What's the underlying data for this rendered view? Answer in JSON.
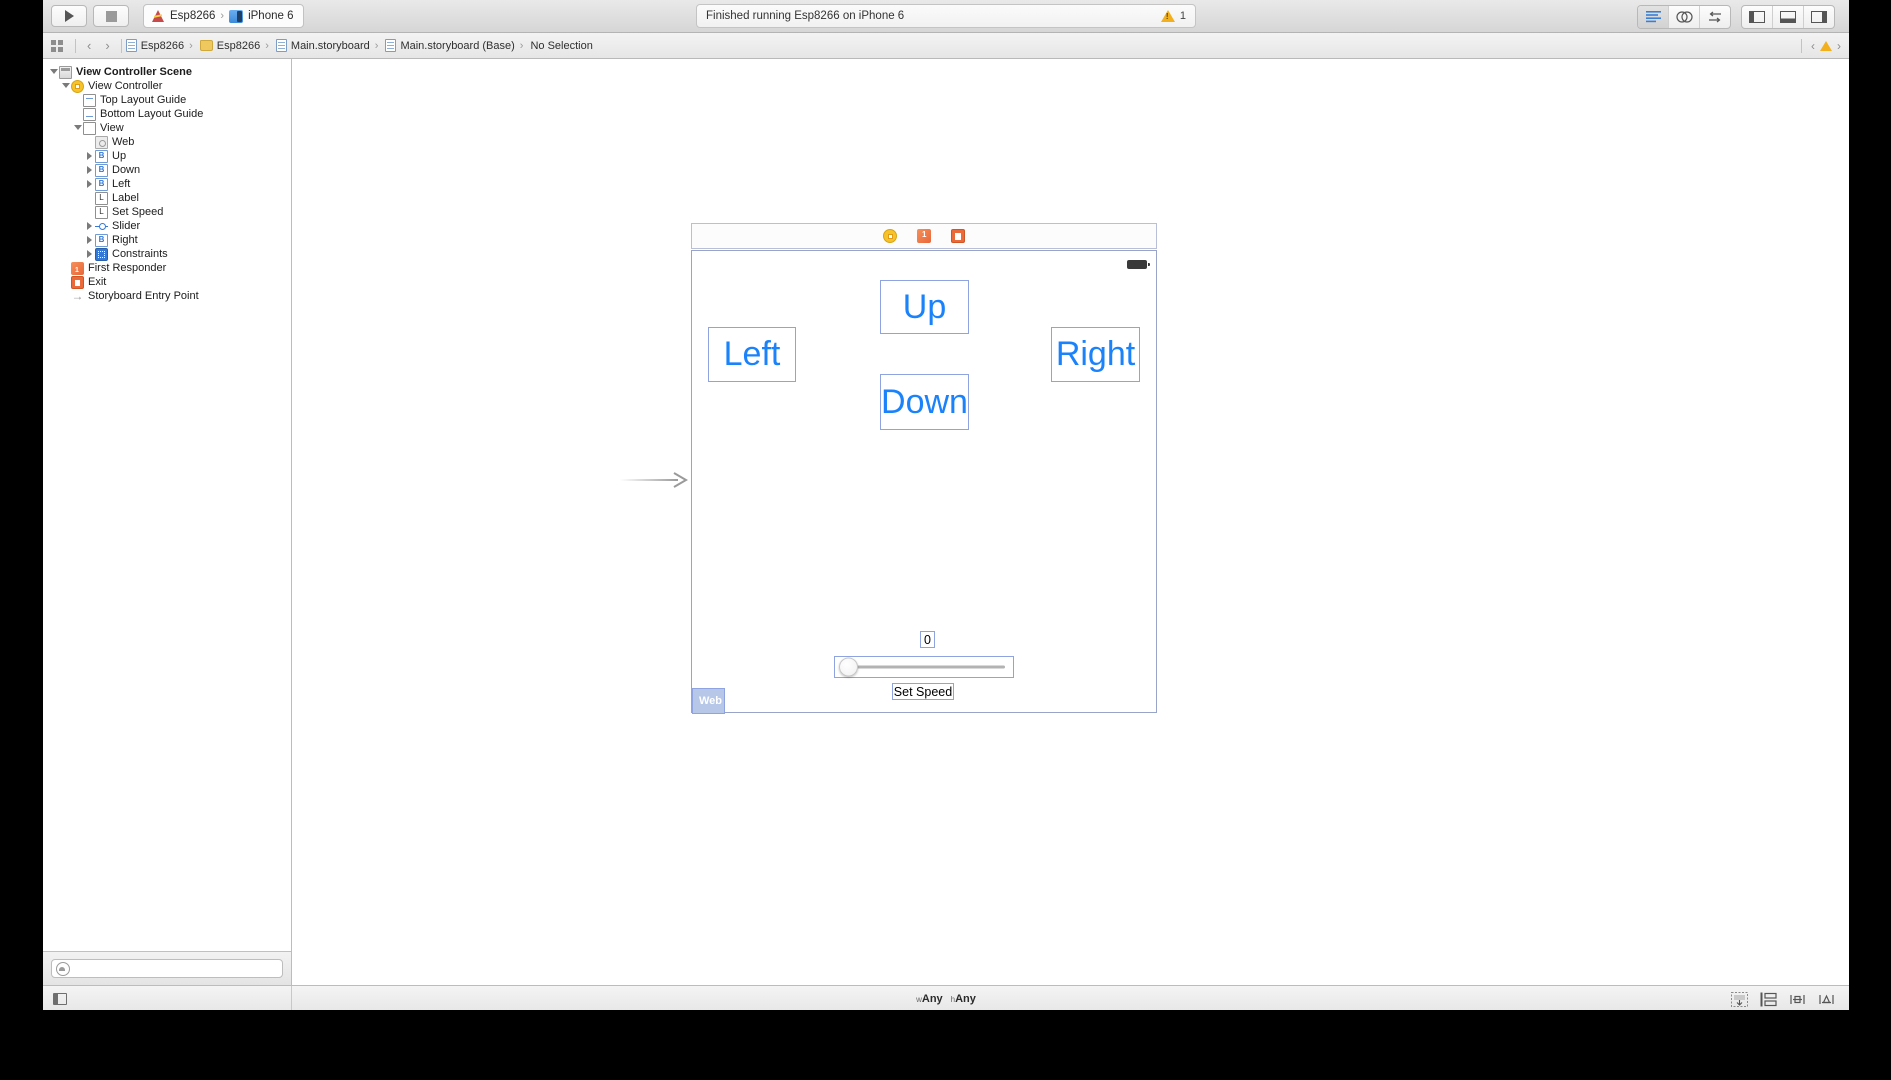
{
  "toolbar": {
    "run_label": "Run",
    "stop_label": "Stop",
    "scheme": {
      "project": "Esp8266",
      "destination": "iPhone 6",
      "separator": "›"
    },
    "status": {
      "message": "Finished running Esp8266 on iPhone 6",
      "warning_count": "1"
    },
    "right_buttons": [
      {
        "name": "standard-editor",
        "label": "Standard Editor"
      },
      {
        "name": "assistant-editor",
        "label": "Assistant Editor"
      },
      {
        "name": "version-editor",
        "label": "Version Editor"
      }
    ],
    "panel_buttons": [
      {
        "name": "navigator-toggle",
        "label": "Hide Navigator"
      },
      {
        "name": "debug-toggle",
        "label": "Hide Debug Area"
      },
      {
        "name": "utilities-toggle",
        "label": "Hide Utilities"
      }
    ]
  },
  "jumpbar": {
    "back_label": "‹",
    "forward_label": "›",
    "crumbs": [
      {
        "label": "Esp8266",
        "icon": "project-icon"
      },
      {
        "label": "Esp8266",
        "icon": "folder-icon"
      },
      {
        "label": "Main.storyboard",
        "icon": "document-icon"
      },
      {
        "label": "Main.storyboard (Base)",
        "icon": "document-icon"
      },
      {
        "label": "No Selection",
        "icon": "none"
      }
    ],
    "separator": "›",
    "issue_prev": "‹",
    "issue_next": "›"
  },
  "outline": {
    "items": [
      {
        "label": "View Controller Scene",
        "indent": 0,
        "disclosure": "open",
        "icon": "scene-icon",
        "bold": true
      },
      {
        "label": "View Controller",
        "indent": 1,
        "disclosure": "open",
        "icon": "view-controller-icon",
        "bold": false
      },
      {
        "label": "Top Layout Guide",
        "indent": 2,
        "disclosure": "none",
        "icon": "top-layout-guide-icon",
        "bold": false
      },
      {
        "label": "Bottom Layout Guide",
        "indent": 2,
        "disclosure": "none",
        "icon": "bottom-layout-guide-icon",
        "bold": false
      },
      {
        "label": "View",
        "indent": 2,
        "disclosure": "open",
        "icon": "view-icon",
        "bold": false
      },
      {
        "label": "Web",
        "indent": 3,
        "disclosure": "none",
        "icon": "web-view-icon",
        "bold": false
      },
      {
        "label": "Up",
        "indent": 3,
        "disclosure": "closed",
        "icon": "button-icon",
        "bold": false
      },
      {
        "label": "Down",
        "indent": 3,
        "disclosure": "closed",
        "icon": "button-icon",
        "bold": false
      },
      {
        "label": "Left",
        "indent": 3,
        "disclosure": "closed",
        "icon": "button-icon",
        "bold": false
      },
      {
        "label": "Label",
        "indent": 3,
        "disclosure": "none",
        "icon": "label-icon",
        "bold": false
      },
      {
        "label": "Set Speed",
        "indent": 3,
        "disclosure": "none",
        "icon": "label-icon",
        "bold": false
      },
      {
        "label": "Slider",
        "indent": 3,
        "disclosure": "closed",
        "icon": "slider-icon",
        "bold": false
      },
      {
        "label": "Right",
        "indent": 3,
        "disclosure": "closed",
        "icon": "button-icon",
        "bold": false
      },
      {
        "label": "Constraints",
        "indent": 3,
        "disclosure": "closed",
        "icon": "constraints-icon",
        "bold": false
      },
      {
        "label": "First Responder",
        "indent": 1,
        "disclosure": "none",
        "icon": "first-responder-icon",
        "bold": false
      },
      {
        "label": "Exit",
        "indent": 1,
        "disclosure": "none",
        "icon": "exit-icon",
        "bold": false
      },
      {
        "label": "Storyboard Entry Point",
        "indent": 1,
        "disclosure": "none",
        "icon": "entry-point-icon",
        "bold": false
      }
    ],
    "filter": {
      "value": "",
      "placeholder": ""
    }
  },
  "canvas": {
    "scene_dock": [
      {
        "name": "view-controller-dock-icon",
        "label": "View Controller"
      },
      {
        "name": "first-responder-dock-icon",
        "label": "First Responder"
      },
      {
        "name": "exit-dock-icon",
        "label": "Exit"
      }
    ],
    "entry_point_label": "Storyboard Entry Point",
    "controls": {
      "up_button": "Up",
      "down_button": "Down",
      "left_button": "Left",
      "right_button": "Right",
      "value_label": "0",
      "set_speed_label": "Set Speed",
      "web_view_label": "Web"
    },
    "accent_blue": "#1a82fb",
    "selection_blue": "#8fa3e0"
  },
  "bottombar": {
    "size_class_w_prefix": "w",
    "size_class_w_value": "Any",
    "size_class_h_prefix": "h",
    "size_class_h_value": "Any",
    "autolayout_buttons": [
      {
        "name": "align-button",
        "label": "Align"
      },
      {
        "name": "pin-button",
        "label": "Pin"
      },
      {
        "name": "resolve-issues-button",
        "label": "Resolve Auto Layout Issues"
      },
      {
        "name": "resizing-behavior-button",
        "label": "Resizing Behavior"
      }
    ],
    "document_outline_label": "Document Outline"
  }
}
